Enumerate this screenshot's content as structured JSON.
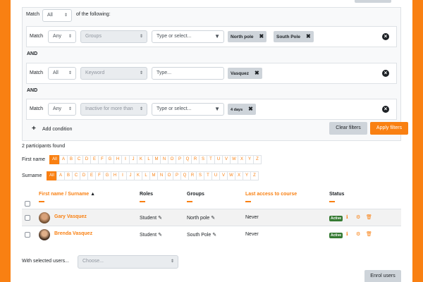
{
  "filters": {
    "match_label": "Match",
    "match_value": "All",
    "of_following": "of the following:",
    "and_label": "AND",
    "rows": [
      {
        "match_label": "Match",
        "match": "Any",
        "field": "Groups",
        "value_placeholder": "Type or select...",
        "tags": [
          "North pole",
          "South Pole"
        ]
      },
      {
        "match_label": "Match",
        "match": "All",
        "field": "Keyword",
        "value_placeholder": "Type...",
        "tags": [
          "Vasquez"
        ]
      },
      {
        "match_label": "Match",
        "match": "Any",
        "field": "Inactive for more than",
        "value_placeholder": "Type or select...",
        "tags": [
          "4 days"
        ]
      }
    ],
    "add_condition": "Add condition",
    "clear_filters": "Clear filters",
    "apply_filters": "Apply filters"
  },
  "participants_found": "2 participants found",
  "initials": {
    "first_name_label": "First name",
    "surname_label": "Surname",
    "all_label": "All",
    "letters": [
      "A",
      "B",
      "C",
      "D",
      "E",
      "F",
      "G",
      "H",
      "I",
      "J",
      "K",
      "L",
      "M",
      "N",
      "O",
      "P",
      "Q",
      "R",
      "S",
      "T",
      "U",
      "V",
      "W",
      "X",
      "Y",
      "Z"
    ]
  },
  "table": {
    "headers": {
      "name_first": "First name",
      "name_sep": " / ",
      "name_sur": "Surname",
      "roles": "Roles",
      "groups": "Groups",
      "last_access": "Last access to course",
      "status": "Status"
    },
    "rows": [
      {
        "name": "Gary Vasquez",
        "role": "Student",
        "group": "North pole",
        "last_access": "Never",
        "status": "Active"
      },
      {
        "name": "Brenda Vasquez",
        "role": "Student",
        "group": "South Pole",
        "last_access": "Never",
        "status": "Active"
      }
    ]
  },
  "bulk": {
    "label": "With selected users...",
    "placeholder": "Choose..."
  },
  "enrol_users": "Enrol users",
  "colors": {
    "accent": "#f98012",
    "active_badge": "#357a32"
  }
}
